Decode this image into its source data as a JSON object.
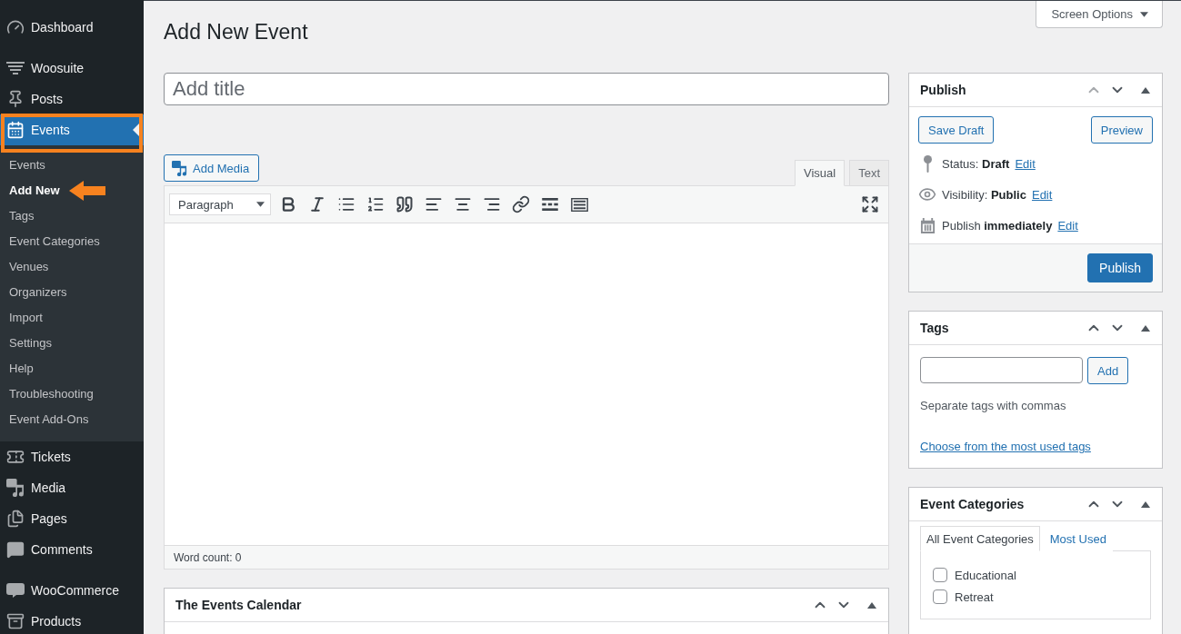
{
  "sidebar": {
    "groups": [
      {
        "items": [
          {
            "label": "Dashboard",
            "selected": false,
            "outlined": false
          }
        ]
      },
      {
        "items": [
          {
            "label": "Woosuite",
            "selected": false,
            "outlined": false
          },
          {
            "label": "Posts",
            "selected": false,
            "outlined": false
          },
          {
            "label": "Events",
            "selected": true,
            "outlined": true,
            "children": [
              {
                "label": "Events",
                "selected": false,
                "arrow": false
              },
              {
                "label": "Add New",
                "selected": true,
                "arrow": true
              },
              {
                "label": "Tags",
                "selected": false,
                "arrow": false
              },
              {
                "label": "Event Categories",
                "selected": false,
                "arrow": false
              },
              {
                "label": "Venues",
                "selected": false,
                "arrow": false
              },
              {
                "label": "Organizers",
                "selected": false,
                "arrow": false
              },
              {
                "label": "Import",
                "selected": false,
                "arrow": false
              },
              {
                "label": "Settings",
                "selected": false,
                "arrow": false
              },
              {
                "label": "Help",
                "selected": false,
                "arrow": false
              },
              {
                "label": "Troubleshooting",
                "selected": false,
                "arrow": false
              },
              {
                "label": "Event Add-Ons",
                "selected": false,
                "arrow": false
              }
            ]
          },
          {
            "label": "Tickets",
            "selected": false,
            "outlined": false
          },
          {
            "label": "Media",
            "selected": false,
            "outlined": false
          },
          {
            "label": "Pages",
            "selected": false,
            "outlined": false
          },
          {
            "label": "Comments",
            "selected": false,
            "outlined": false
          }
        ]
      },
      {
        "items": [
          {
            "label": "WooCommerce",
            "selected": false,
            "outlined": false
          },
          {
            "label": "Products",
            "selected": false,
            "outlined": false
          }
        ]
      }
    ]
  },
  "screen_options": {
    "label": "Screen Options"
  },
  "page_title": "Add New Event",
  "title_field": {
    "placeholder": "Add title"
  },
  "editor": {
    "add_media": "Add Media",
    "tabs": [
      {
        "label": "Visual",
        "selected": true
      },
      {
        "label": "Text",
        "selected": false
      }
    ],
    "format_select": {
      "value": "Paragraph"
    },
    "word_count": "Word count: 0"
  },
  "events_calendar_box": {
    "title": "The Events Calendar",
    "move_up_disabled": false
  },
  "publish_box": {
    "title": "Publish",
    "move_up_disabled": true,
    "save_draft": "Save Draft",
    "preview": "Preview",
    "rows": [
      {
        "text": "Status: **Draft**",
        "link": "Edit"
      },
      {
        "text": "Visibility: **Public**",
        "link": "Edit"
      },
      {
        "text": "Publish **immediately**",
        "link": "Edit"
      }
    ],
    "publish_button": "Publish"
  },
  "tags_box": {
    "title": "Tags",
    "move_up_disabled": false,
    "add_button": "Add",
    "hint": "Separate tags with commas",
    "link": "Choose from the most used tags"
  },
  "categories_box": {
    "title": "Event Categories",
    "move_up_disabled": false,
    "tabs": [
      {
        "label": "All Event Categories",
        "selected": true
      },
      {
        "label": "Most Used",
        "selected": false
      }
    ],
    "items": [
      {
        "label": "Educational",
        "checked": false
      },
      {
        "label": "Retreat",
        "checked": false
      }
    ]
  }
}
